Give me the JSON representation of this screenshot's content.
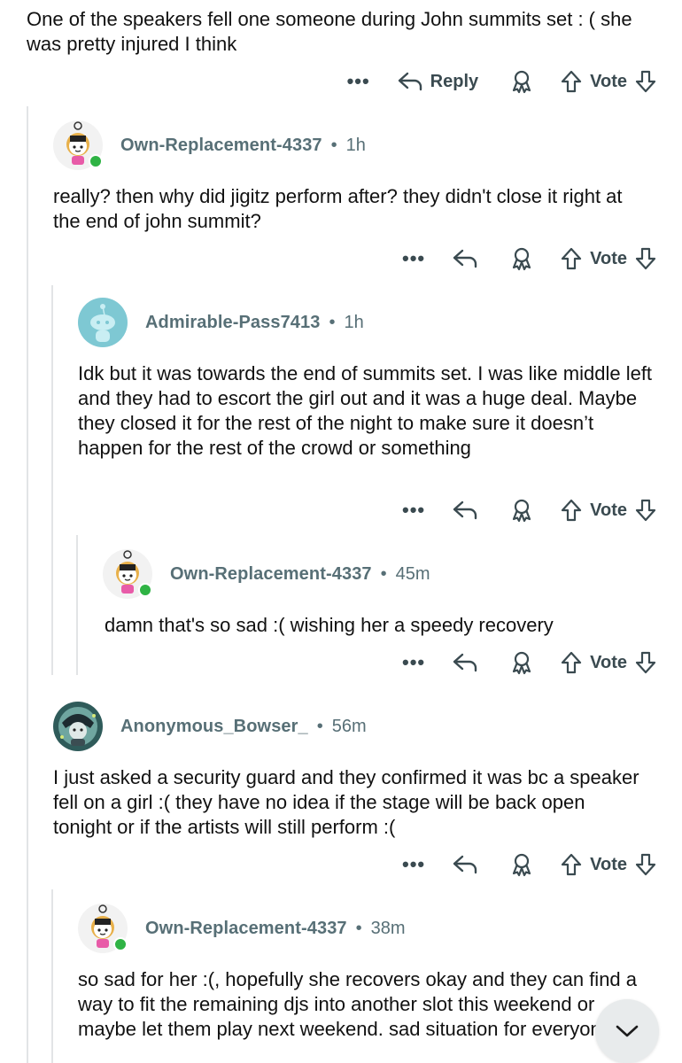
{
  "top_comment": {
    "text": "One of the speakers fell one someone during John summits set : ( she was pretty injured I think"
  },
  "actions": {
    "more": "•••",
    "reply": "Reply",
    "vote": "Vote"
  },
  "comments": [
    {
      "user": "Own-Replacement-4337",
      "sep": "•",
      "time": "1h",
      "text": "really? then why did jigitz perform after? they didn't close it right at the end of john summit?"
    },
    {
      "user": "Admirable-Pass7413",
      "sep": "•",
      "time": "1h",
      "text": "Idk but it was towards the end of summits set. I was like middle left and they had to escort the girl out and it was a huge deal. Maybe they closed it for the rest of the night to make sure it doesn’t happen for the rest of the crowd or something"
    },
    {
      "user": "Own-Replacement-4337",
      "sep": "•",
      "time": "45m",
      "text": "damn that's so sad :( wishing her a speedy recovery"
    },
    {
      "user": "Anonymous_Bowser_",
      "sep": "•",
      "time": "56m",
      "text": "I just asked a security guard and they confirmed it was bc a speaker fell on a girl :( they have no idea if the stage will be back open tonight or if the artists will still perform :("
    },
    {
      "user": "Own-Replacement-4337",
      "sep": "•",
      "time": "38m",
      "text": "so sad for her :(, hopefully she recovers okay and they can find a way to fit the remaining djs into another slot this weekend or maybe let them play next weekend. sad situation for everyone"
    }
  ]
}
